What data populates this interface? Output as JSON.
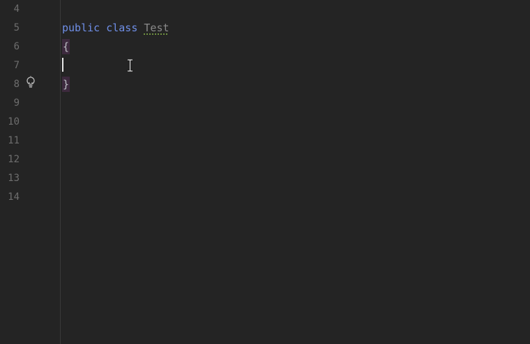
{
  "editor": {
    "line_numbers": [
      "4",
      "5",
      "6",
      "7",
      "8",
      "9",
      "10",
      "11",
      "12",
      "13",
      "14"
    ],
    "lines": {
      "line5": {
        "kw_public": "public",
        "kw_class": "class",
        "class_name": "Test"
      },
      "line6": {
        "open_brace": "{"
      },
      "line7": {
        "text": ""
      },
      "line8": {
        "close_brace": "}"
      }
    },
    "gutter_icons": {
      "line8": "lightbulb-icon"
    }
  },
  "colors": {
    "background": "#242424",
    "keyword": "#6f8fe8",
    "brace_highlight": "#3d2a3e",
    "line_number": "#6e6e6e"
  }
}
